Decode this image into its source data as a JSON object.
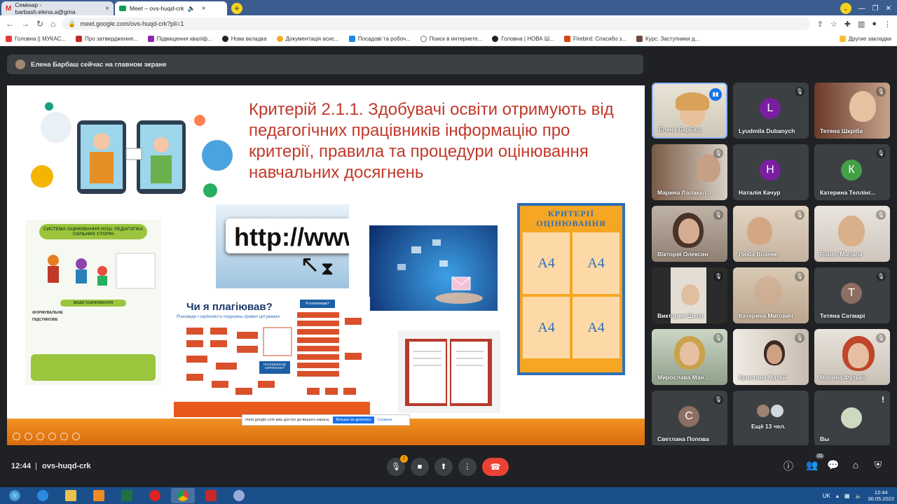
{
  "browser": {
    "tabs": [
      {
        "icon": "gmail-icon",
        "title": "Семінар - barbash.elena.a@gma"
      },
      {
        "icon": "meet-icon",
        "title": "Meet – ovs-huqd-crk"
      }
    ],
    "url": "meet.google.com/ovs-huqd-crk?pli=1",
    "bookmarks": [
      "Головна || МУКАС...",
      "Про затвердження...",
      "Підвищення кваліф...",
      "Нова вкладка",
      "Документація асис...",
      "Посадові та робоч...",
      "Поиск в интернете...",
      "Головна | НОВА Ш...",
      "Firebird: Спасибо з...",
      "Курс: Заступники д..."
    ],
    "other_bookmarks": "Другие закладки"
  },
  "meet": {
    "presenting_banner": "Елена Барбаш сейчас на главном экране",
    "slide": {
      "title": "Критерій 2.1.1. Здобувачі освіти отримують від педагогічних працівників інформацію про критерії, правила та процедури оцінювання навчальних досягнень",
      "infographic_title": "СИСТЕМА ОЦІНЮВАННЯ НУШ: ПЕДАГОГІКА СИЛЬНИХ СТОРІН",
      "infographic_sub": "ВИДИ ОЦІНЮВАННЯ",
      "infographic_items": [
        "ФОРМУВАЛЬНЕ",
        "ПІДСУМКОВЕ"
      ],
      "http_text": "http://www.",
      "plagiarism_title": "Чи я плагіював?",
      "plagiarism_sub": "Різновиди і серйозність порушень правил цитування",
      "plagiarism_q": "Я плагіював?",
      "plagiarism_box": "НАСКІЛЬКИ ЦЕ СЕРЙОЗНО?",
      "poster_title": "КРИТЕРІЇ ОЦІНЮВАННЯ",
      "poster_cells": [
        "А4",
        "А4",
        "А4",
        "А4"
      ],
      "popup_text": "meet.google.com має доступ до вашого екрана.",
      "popup_stop": "Більше не ділитися",
      "popup_hide": "Сховати"
    },
    "participants": [
      {
        "name": "Елена Барбаш",
        "type": "video",
        "speaking": true
      },
      {
        "name": "Lyudmila Dubanych",
        "type": "initial",
        "initial": "L",
        "color": "#7b1fa2"
      },
      {
        "name": "Тетяна Шкріба",
        "type": "video"
      },
      {
        "name": "Марина Лалакул...",
        "type": "video"
      },
      {
        "name": "Наталія Качур",
        "type": "initial",
        "initial": "Н",
        "color": "#7b1fa2"
      },
      {
        "name": "Катерина Теллінг...",
        "type": "initial",
        "initial": "К",
        "color": "#43a047"
      },
      {
        "name": "Вікторія Олексин",
        "type": "video"
      },
      {
        "name": "Люба Возняк",
        "type": "video"
      },
      {
        "name": "Rubec Marjana",
        "type": "video"
      },
      {
        "name": "Виктория Шепа",
        "type": "video"
      },
      {
        "name": "Катерина Мигович",
        "type": "video"
      },
      {
        "name": "Тетяна Сатмарі",
        "type": "initial",
        "initial": "Т",
        "color": "#8d6e63"
      },
      {
        "name": "Мирослава Ман...",
        "type": "video"
      },
      {
        "name": "Кристина Матей",
        "type": "video"
      },
      {
        "name": "Марина Футько",
        "type": "video"
      },
      {
        "name": "Светлана Попова",
        "type": "initial",
        "initial": "С",
        "color": "#8d6e63"
      },
      {
        "name": "Ещё 13 чел.",
        "type": "more"
      },
      {
        "name": "Вы",
        "type": "self"
      }
    ],
    "bottom": {
      "time": "12:44",
      "separator": "|",
      "meeting_code": "ovs-huqd-crk",
      "participants_count": "31",
      "mic_badge": "!"
    }
  },
  "taskbar": {
    "lang": "UK",
    "time": "12:44",
    "date": "30.05.2022"
  }
}
